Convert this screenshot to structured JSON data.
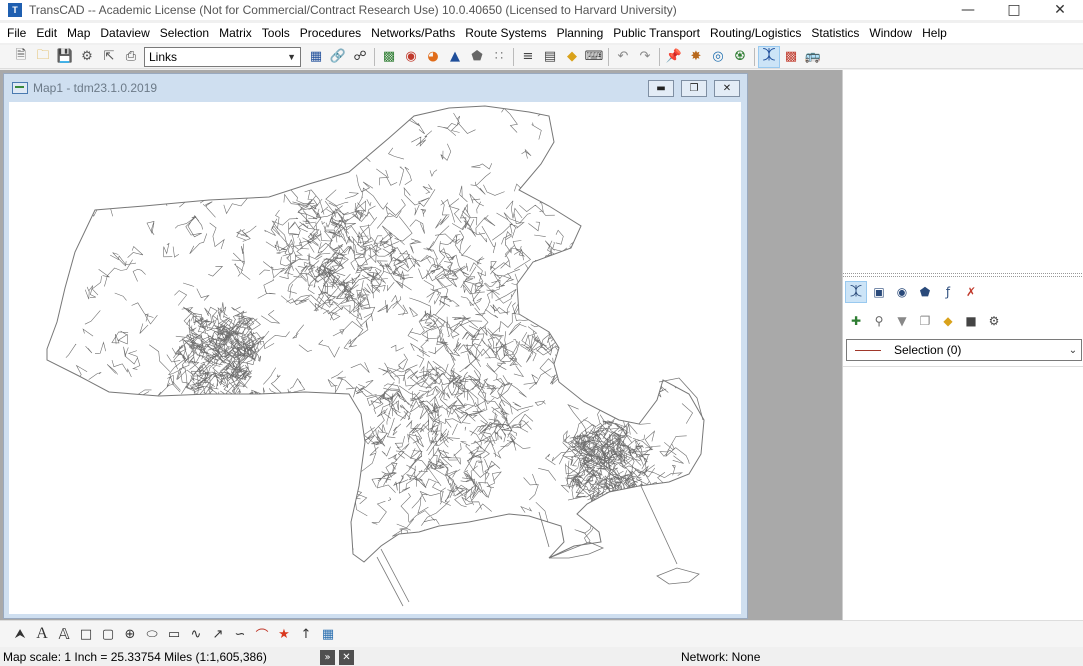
{
  "app": {
    "title": "TransCAD -- Academic License (Not for Commercial/Contract Research Use) 10.0.40650 (Licensed to Harvard University)",
    "icon_name": "transcad-app-icon",
    "window_controls": [
      "minimize-icon",
      "maximize-icon",
      "close-icon"
    ]
  },
  "menu": {
    "items": [
      "File",
      "Edit",
      "Map",
      "Dataview",
      "Selection",
      "Matrix",
      "Tools",
      "Procedures",
      "Networks/Paths",
      "Route Systems",
      "Planning",
      "Public Transport",
      "Routing/Logistics",
      "Statistics",
      "Window",
      "Help"
    ]
  },
  "toolbar": {
    "layer_select_value": "Links",
    "icons": [
      "new-icon",
      "open-icon",
      "save-icon",
      "settings-icon",
      "export-icon",
      "print-icon",
      "dataview-icon",
      "hotlink-icon",
      "find-icon",
      "layers-icon",
      "theme-icon",
      "chart-icon",
      "dot-density-icon",
      "shape-icon",
      "scatter-icon",
      "styles-icon",
      "legend-icon",
      "scale-icon",
      "label-icon",
      "undo-icon",
      "redo-icon",
      "pin-icon",
      "network-icon",
      "target-icon",
      "route-icon",
      "select-tool-icon",
      "map-layers-icon",
      "bus-icon"
    ]
  },
  "map_window": {
    "title": "Map1 - tdm23.1.0.2019",
    "controls": [
      "minimize-icon",
      "restore-icon",
      "close-icon"
    ]
  },
  "selection_panel": {
    "row1_icons": [
      "pointer-select-icon",
      "rectangle-select-icon",
      "circle-select-icon",
      "polygon-select-icon",
      "formula-select-icon",
      "clear-selection-icon"
    ],
    "row2_icons": [
      "add-selection-icon",
      "zoom-selection-icon",
      "filter-selection-icon",
      "copy-selection-icon",
      "tag-selection-icon",
      "filter-icon",
      "selection-settings-icon"
    ],
    "selection_value": "Selection (0)",
    "selection_color": "#a0372a"
  },
  "drawing_tools": [
    "pointer-icon",
    "text-icon",
    "outline-text-icon",
    "rectangle-icon",
    "rounded-rectangle-icon",
    "circle-target-icon",
    "ellipse-icon",
    "freehand-shape-icon",
    "polyline-icon",
    "arrow-icon",
    "curve-icon",
    "arc-icon",
    "star-icon",
    "north-arrow-icon",
    "picture-icon"
  ],
  "status": {
    "scale": "Map scale: 1 Inch = 25.33754 Miles (1:1,605,386)",
    "network": "Network: None",
    "buttons": [
      "expand-icon",
      "close-icon"
    ]
  },
  "colors": {
    "map_line": "#6e6e6e",
    "map_background": "#ffffff",
    "workspace": "#a9a9a9"
  }
}
